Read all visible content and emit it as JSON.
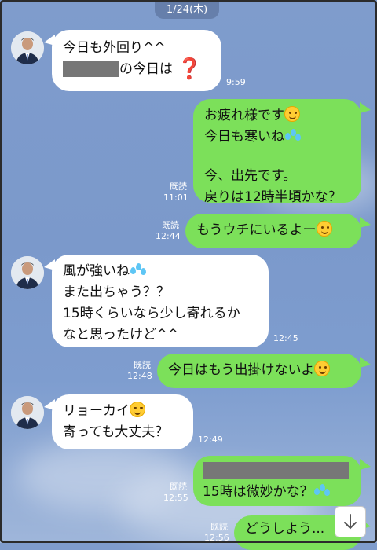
{
  "date": "1/24(木)",
  "messages": [
    {
      "lines": [
        "今日も外回り^^",
        "の今日は"
      ],
      "time": "9:59"
    },
    {
      "lines": [
        "お疲れ様です",
        "今日も寒いね",
        "今、出先です。",
        "戻りは12時半頃かな？"
      ],
      "read": "既読",
      "time": "11:01"
    },
    {
      "lines": [
        "もうウチにいるよー"
      ],
      "read": "既読",
      "time": "12:44"
    },
    {
      "lines": [
        "風が強いね",
        "また出ちゃう？？",
        "15時くらいなら少し寄れるか",
        "なと思ったけど^^"
      ],
      "time": "12:45"
    },
    {
      "lines": [
        "今日はもう出掛けないよ"
      ],
      "read": "既読",
      "time": "12:48"
    },
    {
      "lines": [
        "リョーカイ",
        "寄っても大丈夫？"
      ],
      "time": "12:49"
    },
    {
      "lines": [
        "15時は微妙かな？"
      ],
      "read": "既読",
      "time": "12:55"
    },
    {
      "lines": [
        "どうしよう..."
      ],
      "read": "既読",
      "time": "12:56"
    }
  ],
  "icons": {
    "scroll": "arrow-down-icon",
    "emoji_smile": "smiling-face-icon",
    "emoji_sweat": "sweat-droplets-icon",
    "emoji_wink": "winking-face-icon",
    "emoji_question": "red-question-mark-icon"
  },
  "colors": {
    "sent_bubble": "#7ce05a",
    "received_bubble": "#ffffff",
    "background": "#7f9ccc"
  }
}
